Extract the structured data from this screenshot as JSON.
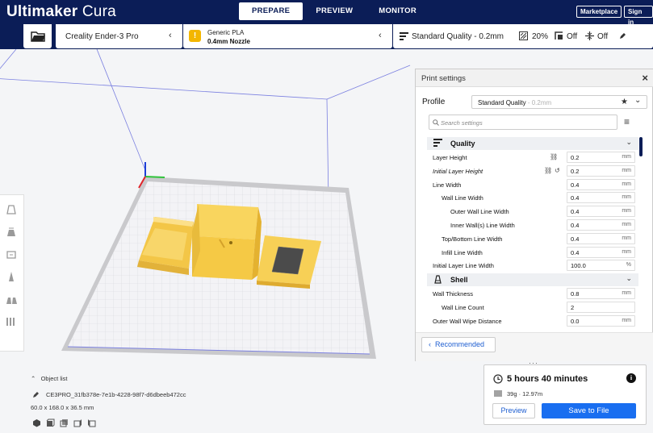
{
  "app": {
    "brand_bold": "Ultimaker",
    "brand_light": " Cura",
    "stages": [
      "PREPARE",
      "PREVIEW",
      "MONITOR"
    ],
    "active_stage": "PREPARE",
    "marketplace": "Marketplace",
    "signin": "Sign in"
  },
  "printer": {
    "name": "Creality Ender-3 Pro"
  },
  "material": {
    "name": "Generic PLA",
    "nozzle": "0.4mm Nozzle",
    "color": "#f3b600"
  },
  "quality": {
    "profile": "Standard Quality - 0.2mm",
    "infill": "20%",
    "support": "Off",
    "adhesion": "Off"
  },
  "settings_panel": {
    "title": "Print settings",
    "profile_label": "Profile",
    "profile_value": "Standard Quality",
    "profile_suffix": " - 0.2mm",
    "search_placeholder": "Search settings",
    "categories": [
      {
        "name": "Quality",
        "rows": [
          {
            "label": "Layer Height",
            "value": "0.2",
            "unit": "mm",
            "indent": 0,
            "italic": false,
            "icons": [
              "link-icon"
            ]
          },
          {
            "label": "Initial Layer Height",
            "value": "0.2",
            "unit": "mm",
            "indent": 0,
            "italic": true,
            "icons": [
              "link-icon",
              "reset-icon"
            ]
          },
          {
            "label": "Line Width",
            "value": "0.4",
            "unit": "mm",
            "indent": 0,
            "italic": false,
            "icons": []
          },
          {
            "label": "Wall Line Width",
            "value": "0.4",
            "unit": "mm",
            "indent": 1,
            "italic": false,
            "icons": []
          },
          {
            "label": "Outer Wall Line Width",
            "value": "0.4",
            "unit": "mm",
            "indent": 2,
            "italic": false,
            "icons": []
          },
          {
            "label": "Inner Wall(s) Line Width",
            "value": "0.4",
            "unit": "mm",
            "indent": 2,
            "italic": false,
            "icons": []
          },
          {
            "label": "Top/Bottom Line Width",
            "value": "0.4",
            "unit": "mm",
            "indent": 1,
            "italic": false,
            "icons": []
          },
          {
            "label": "Infill Line Width",
            "value": "0.4",
            "unit": "mm",
            "indent": 1,
            "italic": false,
            "icons": []
          },
          {
            "label": "Initial Layer Line Width",
            "value": "100.0",
            "unit": "%",
            "indent": 0,
            "italic": false,
            "icons": []
          }
        ]
      },
      {
        "name": "Shell",
        "rows": [
          {
            "label": "Wall Thickness",
            "value": "0.8",
            "unit": "mm",
            "indent": 0,
            "italic": false,
            "icons": []
          },
          {
            "label": "Wall Line Count",
            "value": "2",
            "unit": "",
            "indent": 1,
            "italic": false,
            "icons": []
          },
          {
            "label": "Outer Wall Wipe Distance",
            "value": "0.0",
            "unit": "mm",
            "indent": 0,
            "italic": false,
            "icons": []
          }
        ]
      }
    ],
    "recommended_label": "Recommended"
  },
  "object_info": {
    "list_label": "Object list",
    "object_name": "CE3PRO_31fb378e-7e1b-4228-98f7-d6dbeeb472cc",
    "dimensions": "60.0 x 168.0 x 36.5 mm"
  },
  "estimate": {
    "time": "5 hours 40 minutes",
    "material": "39g · 12.97m",
    "preview_label": "Preview",
    "save_label": "Save to File"
  }
}
